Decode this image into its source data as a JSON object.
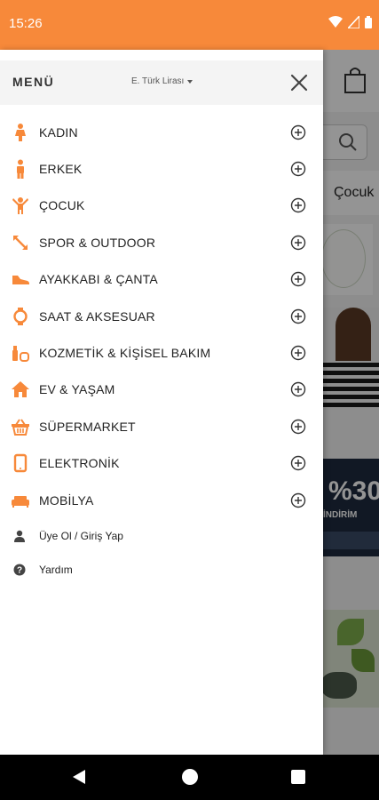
{
  "status_bar": {
    "time": "15:26"
  },
  "drawer": {
    "title": "MENÜ",
    "currency": "E. Türk Lirası",
    "categories": [
      {
        "label": "KADIN",
        "icon": "woman-icon"
      },
      {
        "label": "ERKEK",
        "icon": "man-icon"
      },
      {
        "label": "ÇOCUK",
        "icon": "child-icon"
      },
      {
        "label": "SPOR & OUTDOOR",
        "icon": "sports-arrows-icon"
      },
      {
        "label": "AYAKKABI & ÇANTA",
        "icon": "shoe-icon"
      },
      {
        "label": "SAAT & AKSESUAR",
        "icon": "watch-icon"
      },
      {
        "label": "KOZMETİK & KİŞİSEL BAKIM",
        "icon": "cosmetics-icon"
      },
      {
        "label": "EV & YAŞAM",
        "icon": "home-icon"
      },
      {
        "label": "SÜPERMARKET",
        "icon": "basket-icon"
      },
      {
        "label": "ELEKTRONİK",
        "icon": "tablet-icon"
      },
      {
        "label": "MOBİLYA",
        "icon": "sofa-icon"
      }
    ],
    "secondary": [
      {
        "label": "Üye Ol / Giriş Yap",
        "icon": "user-icon"
      },
      {
        "label": "Yardım",
        "icon": "help-icon"
      }
    ]
  },
  "background": {
    "tab_label": "Çocuk",
    "banner_number": "%30",
    "banner_text": "İNDİRİM"
  },
  "colors": {
    "accent": "#f7893a",
    "icon_orange": "#f7893a"
  }
}
